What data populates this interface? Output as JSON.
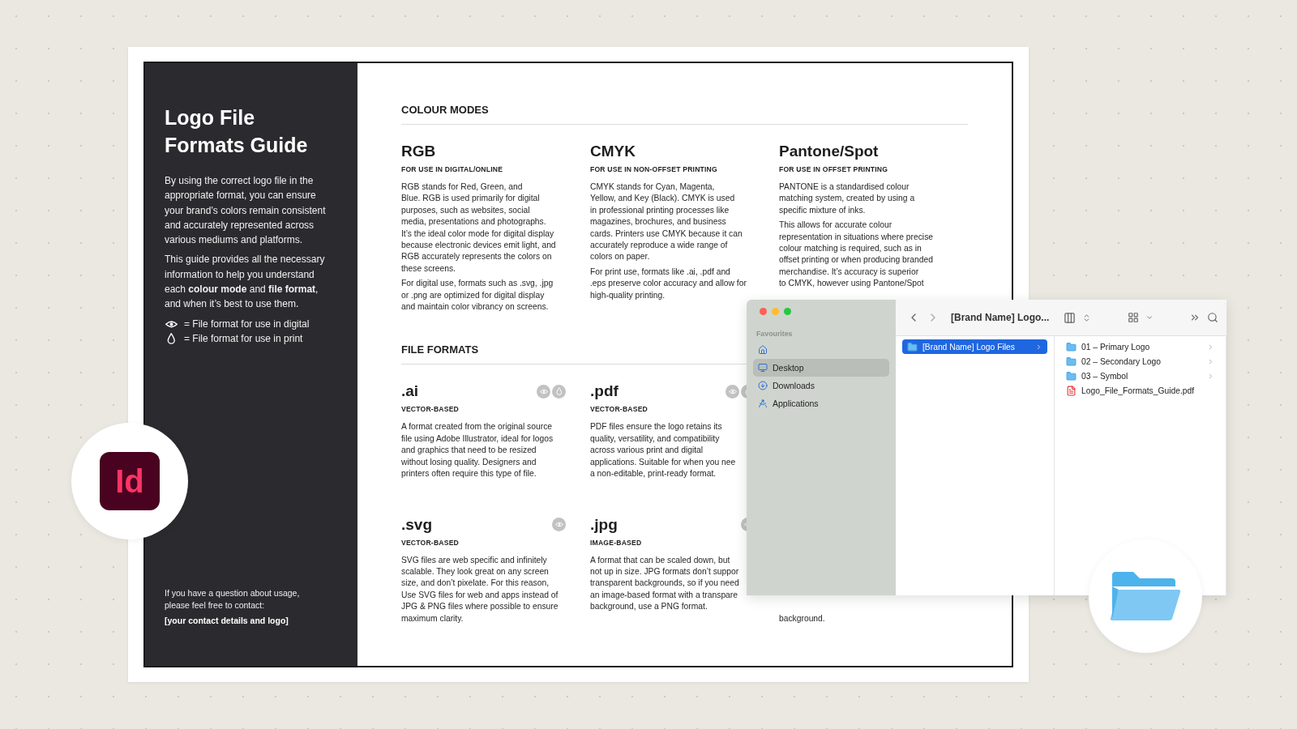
{
  "guide": {
    "title": "Logo File\nFormats Guide",
    "intro": [
      "By using the correct logo file in the\nappropriate format, you can ensure\nyour brand’s colors remain consistent\nand accurately represented across\nvarious mediums and platforms.",
      "This guide provides all the necessary\ninformation to help you understand\neach **colour mode** and **file format**,\nand when it’s best to use them."
    ],
    "legend": [
      {
        "kind": "digital",
        "text": "= File format for use in digital"
      },
      {
        "kind": "print",
        "text": "= File format for use in print"
      }
    ],
    "contact": {
      "text": "If you have a question about usage,\nplease feel free to contact:",
      "details": "[your contact details and logo]"
    }
  },
  "colour_modes": {
    "heading": "COLOUR MODES",
    "items": [
      {
        "name": "RGB",
        "use": "FOR USE IN DIGITAL/ONLINE",
        "paragraphs": [
          "RGB stands for Red, Green, and\nBlue. RGB is used primarily for digital\npurposes, such as websites, social\nmedia, presentations and photographs.\nIt’s the ideal color mode for digital display\nbecause electronic devices emit light, and\nRGB accurately represents the colors on\nthese screens.",
          "For digital use, formats such as .svg, .jpg\nor .png are optimized for digital display\nand maintain color vibrancy on screens."
        ]
      },
      {
        "name": "CMYK",
        "use": "FOR USE IN NON-OFFSET PRINTING",
        "paragraphs": [
          "CMYK stands for Cyan, Magenta,\nYellow, and Key (Black). CMYK is used\nin professional printing processes like\nmagazines, brochures, and business\ncards. Printers use CMYK because it can\naccurately reproduce a wide range of\ncolors on paper.",
          "For print use, formats like .ai, .pdf and\n.eps preserve color accuracy and allow for\nhigh-quality printing."
        ]
      },
      {
        "name": "Pantone/Spot",
        "use": "FOR USE IN OFFSET PRINTING",
        "paragraphs": [
          "PANTONE is a standardised colour\nmatching system, created by using a\nspecific mixture of inks.",
          "This allows for accurate colour\nrepresentation in situations where precise\ncolour matching is required, such as in\noffset printing or when producing branded\nmerchandise. It’s accuracy is superior\nto CMYK, however using Pantone/Spot"
        ]
      }
    ]
  },
  "file_formats": {
    "heading": "FILE FORMATS",
    "items": [
      {
        "kind": "card",
        "name": ".ai",
        "type": "VECTOR-BASED",
        "digital": true,
        "print": true,
        "description": "A format created from the original source\nfile using Adobe Illustrator, ideal for logos\nand graphics that need to be resized\nwithout losing quality. Designers and\nprinters often require this type of file."
      },
      {
        "kind": "card",
        "name": ".pdf",
        "type": "VECTOR-BASED",
        "digital": true,
        "print": true,
        "description": "PDF files ensure the logo retains its\nquality, versatility, and compatibility\nacross various print and digital\napplications. Suitable for when you nee\na non-editable, print-ready format."
      },
      {
        "kind": "hidden"
      },
      {
        "kind": "card",
        "name": ".svg",
        "type": "VECTOR-BASED",
        "digital": true,
        "print": false,
        "description": "SVG files are web specific and infinitely\nscalable. They look great on any screen\nsize, and don’t pixelate. For this reason,\nUse SVG files for web and apps instead of\nJPG & PNG files where possible to ensure\nmaximum clarity."
      },
      {
        "kind": "card",
        "name": ".jpg",
        "type": "IMAGE-BASED",
        "digital": true,
        "print": false,
        "description": "A format that can be scaled down, but\nnot up in size. JPG formats don’t suppor\ntransparent backgrounds, so if you need\nan image-based format with a transpare\nbackground, use a PNG format."
      },
      {
        "kind": "fragment",
        "description": "background."
      }
    ]
  },
  "finder": {
    "title": "[Brand Name] Logo...",
    "sidebar": {
      "heading": "Favourites",
      "items": [
        {
          "kind": "home",
          "selected": false
        },
        {
          "kind": "desktop",
          "label": "Desktop",
          "selected": true
        },
        {
          "kind": "downloads",
          "label": "Downloads",
          "selected": false
        },
        {
          "kind": "applications",
          "label": "Applications",
          "selected": false
        }
      ]
    },
    "column_1": [
      {
        "kind": "folder",
        "label": "[Brand Name] Logo Files",
        "selected": true
      }
    ],
    "column_2": [
      {
        "kind": "folder",
        "label": "01 – Primary Logo",
        "selected": false
      },
      {
        "kind": "folder",
        "label": "02 – Secondary Logo",
        "selected": false
      },
      {
        "kind": "folder",
        "label": "03 – Symbol",
        "selected": false
      },
      {
        "kind": "pdf",
        "label": "Logo_File_Formats_Guide.pdf",
        "selected": false
      }
    ]
  },
  "app_badge": {
    "label": "Id"
  }
}
